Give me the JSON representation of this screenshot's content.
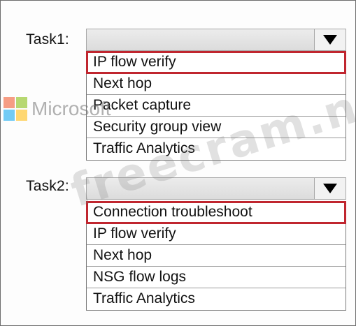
{
  "tasks": [
    {
      "label": "Task1:",
      "selected_value": "",
      "options": [
        {
          "label": "IP flow verify",
          "selected": true
        },
        {
          "label": "Next hop",
          "selected": false
        },
        {
          "label": "Packet capture",
          "selected": false
        },
        {
          "label": "Security group view",
          "selected": false
        },
        {
          "label": "Traffic Analytics",
          "selected": false
        }
      ]
    },
    {
      "label": "Task2:",
      "selected_value": "",
      "options": [
        {
          "label": "Connection troubleshoot",
          "selected": true
        },
        {
          "label": "IP flow verify",
          "selected": false
        },
        {
          "label": "Next hop",
          "selected": false
        },
        {
          "label": "NSG flow logs",
          "selected": false
        },
        {
          "label": "Traffic Analytics",
          "selected": false
        }
      ]
    }
  ],
  "watermarks": {
    "logo_text": "Microsoft",
    "site_text": "freecram.net"
  },
  "colors": {
    "selection_outline": "#c0262f",
    "dropdown_bg": "#dcdcdc",
    "logo_red": "#f25022",
    "logo_green": "#7fba00",
    "logo_blue": "#00a4ef",
    "logo_yellow": "#ffb900"
  },
  "icons": {
    "dropdown_arrow": "chevron-down-icon"
  }
}
